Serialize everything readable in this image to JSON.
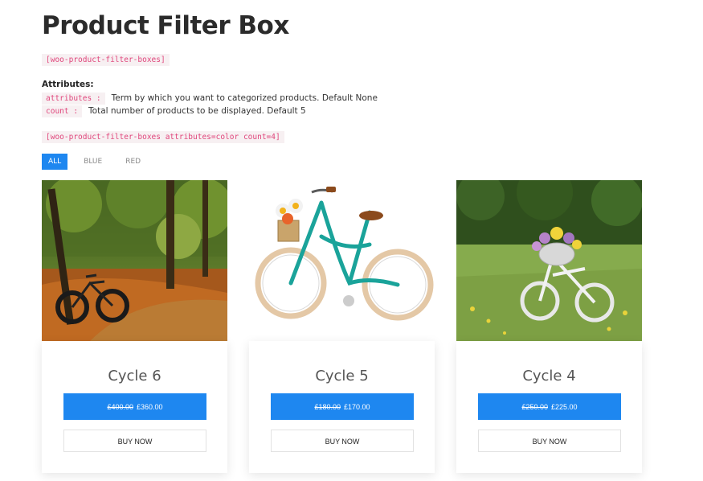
{
  "page": {
    "title": "Product Filter Box",
    "shortcode_basic": "[woo-product-filter-boxes]",
    "attributes_heading": "Attributes:",
    "attributes": [
      {
        "code": "attributes :",
        "desc": "Term by which you want to categorized products. Default None"
      },
      {
        "code": "count :",
        "desc": "Total number of products to be displayed. Default 5"
      }
    ],
    "shortcode_example": "[woo-product-filter-boxes attributes=color count=4]"
  },
  "filters": [
    {
      "label": "ALL",
      "active": true
    },
    {
      "label": "BLUE",
      "active": false
    },
    {
      "label": "RED",
      "active": false
    }
  ],
  "products": [
    {
      "name": "Cycle 6",
      "old_price": "£400.00",
      "new_price": "£360.00",
      "buy_label": "BUY NOW",
      "image": "fat-bike-forest-photo"
    },
    {
      "name": "Cycle 5",
      "old_price": "£180.00",
      "new_price": "£170.00",
      "buy_label": "BUY NOW",
      "image": "teal-cruiser-bicycle-illustration"
    },
    {
      "name": "Cycle 4",
      "old_price": "£250.00",
      "new_price": "£225.00",
      "buy_label": "BUY NOW",
      "image": "white-bicycle-meadow-photo"
    }
  ],
  "colors": {
    "accent": "#1e87f0",
    "code_text": "#e0467c",
    "code_bg": "#f7f0f2"
  }
}
